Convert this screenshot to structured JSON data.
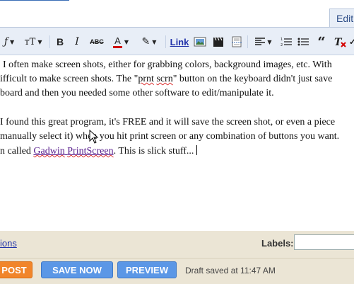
{
  "tabs": {
    "edit_html_partial": "Edit"
  },
  "toolbar": {
    "font_label": "ƒ",
    "size_label": "тT",
    "bold_label": "B",
    "italic_label": "I",
    "strike_label": "ABC",
    "text_color_label": "A",
    "highlight_label": "✎",
    "link_label": "Link",
    "text_color_hex": "#d00000"
  },
  "editor": {
    "p1": {
      "l1": "I often make screen shots, either for grabbing colors, background images, etc.  With",
      "l2a": "ifficult to make screen shots.  The \"",
      "l2b": "prnt",
      "l2c": " ",
      "l2d": "scrn",
      "l2e": "\" button on the keyboard didn't just save",
      "l3": "board and then you needed some other software to edit/manipulate it."
    },
    "p2": {
      "l1": "I found this great program, it's FREE and it will save the screen shot, or even a piece",
      "l2": "manually select it) when you hit print screen or any combination of buttons you want.",
      "l3a": "n called ",
      "l3b": "Gadwin",
      "l3c": " ",
      "l3d": "PrintScreen",
      "l3e": ".  This is slick stuff..."
    }
  },
  "footer": {
    "options_label": "ions",
    "labels_label": "Labels:",
    "labels_value": "",
    "publish_label": "POST",
    "save_label": "SAVE NOW",
    "preview_label": "PREVIEW",
    "status_text": "Draft saved at 11:47 AM"
  }
}
